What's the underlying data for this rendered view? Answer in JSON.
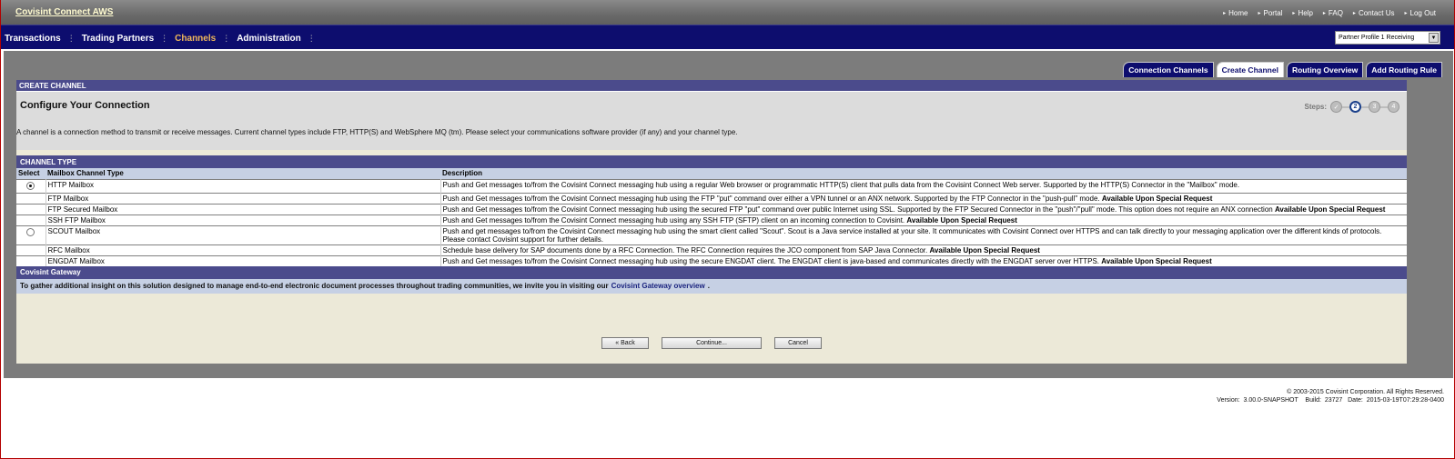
{
  "app": {
    "title": "Covisint Connect AWS"
  },
  "toplinks": [
    "Home",
    "Portal",
    "Help",
    "FAQ",
    "Contact Us",
    "Log Out"
  ],
  "nav": {
    "items": [
      "Transactions",
      "Trading Partners",
      "Channels",
      "Administration"
    ],
    "active": "Channels"
  },
  "profile_select": {
    "value": "Partner Profile 1 Receiving"
  },
  "tabs": [
    "Connection Channels",
    "Create Channel",
    "Routing Overview",
    "Add Routing Rule"
  ],
  "active_tab": "Create Channel",
  "panel": {
    "header": "CREATE CHANNEL",
    "title": "Configure Your Connection",
    "steps_label": "Steps:",
    "steps": [
      "✓",
      "2",
      "3",
      "4"
    ],
    "current_step": 2,
    "intro": "A channel is a connection method to transmit or receive messages. Current channel types include FTP, HTTP(S) and WebSphere MQ (tm). Please select your communications software provider (if any) and your channel type."
  },
  "channel_type": {
    "header": "CHANNEL TYPE",
    "columns": [
      "Select",
      "Mailbox Channel Type",
      "Description"
    ],
    "rows": [
      {
        "radio": true,
        "checked": true,
        "type": "HTTP Mailbox",
        "desc": "Push and Get messages to/from the Covisint Connect messaging hub using a regular Web browser or programmatic HTTP(S) client that pulls data from the Covisint Connect Web server. Supported by the HTTP(S) Connector in the \"Mailbox\" mode.",
        "bold": ""
      },
      {
        "radio": false,
        "checked": false,
        "type": "FTP Mailbox",
        "desc": "Push and Get messages to/from the Covisint Connect messaging hub using the FTP \"put\" command over either a VPN tunnel or an ANX network. Supported by the FTP Connector in the \"push-pull\" mode. ",
        "bold": "Available Upon Special Request"
      },
      {
        "radio": false,
        "checked": false,
        "type": "FTP Secured Mailbox",
        "desc": "Push and Get messages to/from the Covisint Connect messaging hub using the secured FTP \"put\" command over public Internet using SSL. Supported by the FTP Secured Connector in the \"push\"/\"pull\" mode. This option does not require an ANX connection ",
        "bold": "Available Upon Special Request"
      },
      {
        "radio": false,
        "checked": false,
        "type": "SSH FTP Mailbox",
        "desc": "Push and Get messages to/from the Covisint Connect messaging hub using any SSH FTP (SFTP) client on an incoming connection to Covisint. ",
        "bold": "Available Upon Special Request"
      },
      {
        "radio": true,
        "checked": false,
        "type": "SCOUT Mailbox",
        "desc": "Push and get messages to/from the Covisint Connect messaging hub using the smart client called \"Scout\". Scout is a Java service installed at your site. It communicates with Covisint Connect over HTTPS and can talk directly to your messaging application over the different kinds of protocols. Please contact Covisint support for further details.",
        "bold": ""
      },
      {
        "radio": false,
        "checked": false,
        "type": "RFC Mailbox",
        "desc": "Schedule base delivery for SAP documents done by a RFC Connection. The RFC Connection requires the JCO component from SAP Java Connector. ",
        "bold": "Available Upon Special Request"
      },
      {
        "radio": false,
        "checked": false,
        "type": "ENGDAT Mailbox",
        "desc": "Push and Get messages to/from the Covisint Connect messaging hub using the secure ENGDAT client. The ENGDAT client is java-based and communicates directly with the ENGDAT server over HTTPS. ",
        "bold": "Available Upon Special Request"
      }
    ]
  },
  "gateway": {
    "header": "Covisint Gateway",
    "text": "To gather additional insight on this solution designed to manage end-to-end electronic document processes throughout trading communities, we invite you in visiting our",
    "link": "Covisint Gateway overview",
    "tail": "."
  },
  "buttons": {
    "back": "« Back",
    "continue": "Continue...",
    "cancel": "Cancel"
  },
  "footer": {
    "copyright": "© 2003-2015 Covisint Corporation. All Rights Reserved.",
    "version": "Version:  3.00.0-SNAPSHOT    Build:  23727   Date:  2015-03-19T07:29:28-0400"
  }
}
